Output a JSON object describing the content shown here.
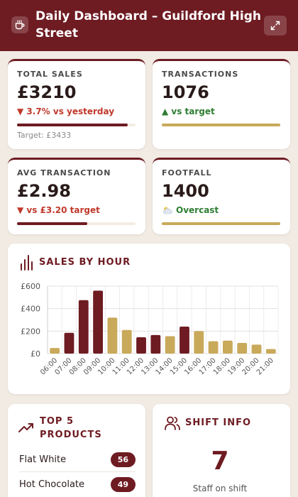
{
  "header": {
    "title": "Daily Dashboard – Guildford High Street",
    "app_icon": "coffee-cup-icon",
    "expand_icon": "expand-icon"
  },
  "colors": {
    "brand": "#6e1b22",
    "gold": "#c9a95a",
    "down": "#c0392b",
    "up": "#2e7d32"
  },
  "kpis": {
    "total_sales": {
      "label": "TOTAL SALES",
      "value": "£3210",
      "delta": "▼ 3.7% vs yesterday",
      "target": "Target: £3433",
      "progress": 0.935
    },
    "transactions": {
      "label": "TRANSACTIONS",
      "value": "1076",
      "delta": "▲ vs target",
      "progress": 1.0
    },
    "avg_transaction": {
      "label": "AVG TRANSACTION",
      "value": "£2.98",
      "delta": "▼ vs £3.20 target",
      "progress": 0.59
    },
    "footfall": {
      "label": "FOOTFALL",
      "value": "1400",
      "weather_icon": "partly-cloudy-icon",
      "weather": "Overcast",
      "progress": 1.0
    }
  },
  "sales_chart": {
    "title": "SALES BY HOUR",
    "icon": "bar-chart-icon"
  },
  "chart_data": {
    "type": "bar",
    "title": "SALES BY HOUR",
    "categories": [
      "06:00",
      "07:00",
      "08:00",
      "09:00",
      "10:00",
      "11:00",
      "12:00",
      "13:00",
      "14:00",
      "15:00",
      "16:00",
      "17:00",
      "18:00",
      "19:00",
      "20:00",
      "21:00"
    ],
    "values": [
      50,
      185,
      475,
      560,
      320,
      210,
      145,
      165,
      155,
      240,
      200,
      110,
      115,
      95,
      80,
      40
    ],
    "bar_colors": [
      "#c9a95a",
      "#6e1b22",
      "#6e1b22",
      "#6e1b22",
      "#c9a95a",
      "#c9a95a",
      "#6e1b22",
      "#6e1b22",
      "#c9a95a",
      "#6e1b22",
      "#c9a95a",
      "#c9a95a",
      "#c9a95a",
      "#c9a95a",
      "#c9a95a",
      "#c9a95a"
    ],
    "y_ticks": [
      0,
      200,
      400,
      600
    ],
    "y_tick_labels": [
      "£0",
      "£200",
      "£400",
      "£600"
    ],
    "ylim": [
      0,
      600
    ],
    "grid": true
  },
  "top_products": {
    "title_line1": "TOP 5",
    "title_line2": "PRODUCTS",
    "icon": "trending-up-icon",
    "items": [
      {
        "name": "Flat White",
        "count": "56"
      },
      {
        "name": "Hot Chocolate",
        "count": "49"
      }
    ]
  },
  "shift": {
    "title": "SHIFT INFO",
    "icon": "users-icon",
    "staff_count": "7",
    "staff_label": "Staff on shift"
  }
}
